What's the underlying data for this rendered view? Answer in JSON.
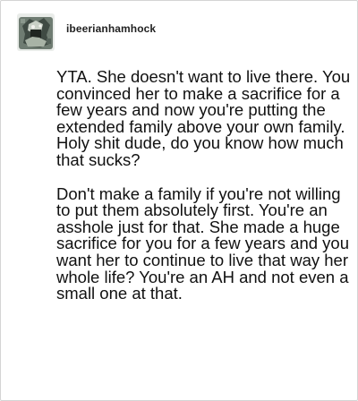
{
  "post": {
    "username": "ibeerianhamhock",
    "avatar_icon": "user-avatar",
    "paragraphs": [
      "YTA. She doesn't want to live there. You convinced her to make a sacrifice for a few years and now you're putting the extended family above your own family. Holy shit dude, do you know how much that sucks?",
      "Don't make a family if you're not willing to put them absolutely first. You're an asshole just for that. She made a huge sacrifice for you for a few years and you want her to continue to live that way her whole life? You're an AH and not even a small one at that."
    ]
  },
  "colors": {
    "border": "#d4d4d4",
    "text": "#111111",
    "username": "#222222"
  }
}
